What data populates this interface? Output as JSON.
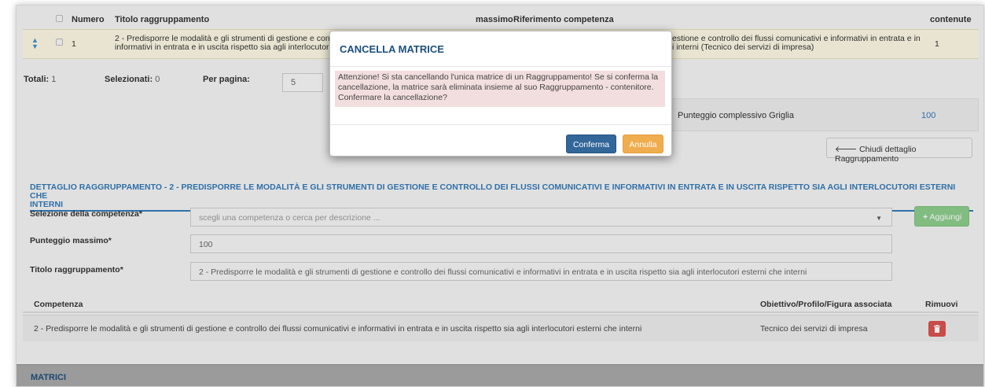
{
  "table": {
    "headers": {
      "numero": "Numero",
      "titolo": "Titolo raggruppamento",
      "massimo": "massimo",
      "riferimento": "Riferimento competenza",
      "contenute": "contenute"
    },
    "row": {
      "numero": "1",
      "titolo_line1": "2 - Predisporre le modalità e gli strumenti di gestione e contro",
      "titolo_line2": "informativi in entrata e in uscita rispetto sia agli interlocutori e",
      "riferimento_line1": "estione e controllo dei flussi comunicativi e informativi in entrata e in",
      "riferimento_line2": "i interni (Tecnico dei servizi di impresa)",
      "contenute": "1"
    }
  },
  "pagination": {
    "totali_label": "Totali:",
    "totali_value": "1",
    "selezionati_label": "Selezionati:",
    "selezionati_value": "0",
    "per_pagina_label": "Per pagina:",
    "per_pagina_value": "5"
  },
  "punteggio": {
    "label": "Punteggio complessivo Griglia",
    "value": "100"
  },
  "chiudi_button": "Chiudi dettaglio Raggruppamento",
  "dettaglio": {
    "title_line1": "DETTAGLIO RAGGRUPPAMENTO - 2 - PREDISPORRE LE MODALITÀ E GLI STRUMENTI DI GESTIONE E CONTROLLO DEI FLUSSI COMUNICATIVI E INFORMATIVI IN ENTRATA E IN USCITA RISPETTO SIA AGLI INTERLOCUTORI ESTERNI CHE",
    "title_line2": "INTERNI",
    "competenza_label": "Selezione della competenza*",
    "competenza_placeholder": "scegli una competenza o cerca per descrizione ...",
    "aggiungi_button": "Aggiungi",
    "punteggio_label": "Punteggio massimo*",
    "punteggio_value": "100",
    "titolo_label": "Titolo raggruppamento*",
    "titolo_value": "2 - Predisporre le modalità e gli strumenti di gestione e controllo dei flussi comunicativi e informativi in entrata e in uscita rispetto sia agli interlocutori esterni che interni"
  },
  "competenze_table": {
    "headers": {
      "competenza": "Competenza",
      "obiettivo": "Obiettivo/Profilo/Figura associata",
      "rimuovi": "Rimuovi"
    },
    "rows": [
      {
        "competenza": "2 - Predisporre le modalità e gli strumenti di gestione e controllo dei flussi comunicativi e informativi in entrata e in uscita rispetto sia agli interlocutori esterni che interni",
        "obiettivo": "Tecnico dei servizi di impresa"
      }
    ]
  },
  "matrici_title": "MATRICI",
  "modal": {
    "title": "CANCELLA MATRICE",
    "message_line1": "Attenzione! Si sta cancellando l'unica matrice di un Raggruppamento! Se si conferma la",
    "message_line2": "cancellazione, la matrice sarà eliminata insieme al suo Raggruppamento - contenitore.",
    "message_line3": "Confermare la cancellazione?",
    "confirm_button": "Conferma",
    "cancel_button": "Annulla"
  },
  "colors": {
    "primary": "#337ab7",
    "title_dark": "#1d4f7d",
    "warning_bg": "#f2dede",
    "confirm": "#336699",
    "cancel": "#f0ad4e",
    "success": "#8ccc8c",
    "danger": "#d9534f"
  }
}
